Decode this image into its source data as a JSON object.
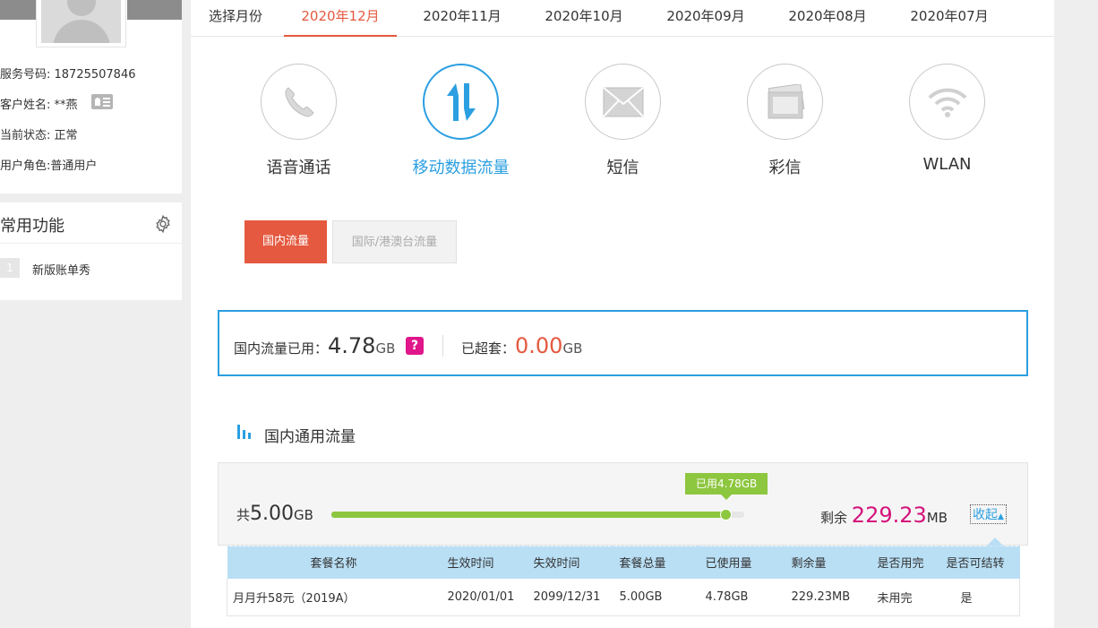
{
  "profile": {
    "service_number": "服务号码: 18725507846",
    "customer_name": "客户姓名: **燕",
    "status": "当前状态: 正常",
    "role": "用户角色:普通用户"
  },
  "common_functions": {
    "title": "常用功能",
    "items": [
      {
        "index": "1",
        "label": "新版账单秀"
      }
    ]
  },
  "months": {
    "label": "选择月份",
    "tabs": [
      "2020年12月",
      "2020年11月",
      "2020年10月",
      "2020年09月",
      "2020年08月",
      "2020年07月"
    ],
    "selected": "2020年12月"
  },
  "services": [
    {
      "label": "语音通话",
      "icon": "phone-icon"
    },
    {
      "label": "移动数据流量",
      "icon": "data-transfer-icon",
      "active": true
    },
    {
      "label": "短信",
      "icon": "envelope-icon"
    },
    {
      "label": "彩信",
      "icon": "picture-message-icon"
    },
    {
      "label": "WLAN",
      "icon": "wifi-icon"
    }
  ],
  "subtabs": {
    "domestic": "国内流量",
    "international": "国际/港澳台流量"
  },
  "usage": {
    "used_label": "国内流量已用：",
    "used_value": "4.78",
    "used_unit": "GB",
    "help": "?",
    "over_label": "已超套：",
    "over_value": "0.00",
    "over_unit": "GB"
  },
  "section": {
    "title": "国内通用流量"
  },
  "flow": {
    "total_prefix": "共",
    "total_value": "5.00",
    "total_unit": "GB",
    "used_tip": "已用4.78GB",
    "used_fraction": 0.956,
    "remain_label": "剩余",
    "remain_value": "229.23",
    "remain_unit": "MB",
    "collapse_label": "收起"
  },
  "table": {
    "headers": [
      "套餐名称",
      "生效时间",
      "失效时间",
      "套餐总量",
      "已使用量",
      "剩余量",
      "是否用完",
      "是否可结转"
    ],
    "rows": [
      [
        "月月升58元（2019A）",
        "2020/01/01",
        "2099/12/31",
        "5.00GB",
        "4.78GB",
        "229.23MB",
        "未用完",
        "是"
      ]
    ]
  },
  "colors": {
    "accent_blue": "#2b9fe1",
    "accent_red": "#e4593f",
    "accent_pink": "#d4137b",
    "bar_green": "#8dc63f"
  }
}
